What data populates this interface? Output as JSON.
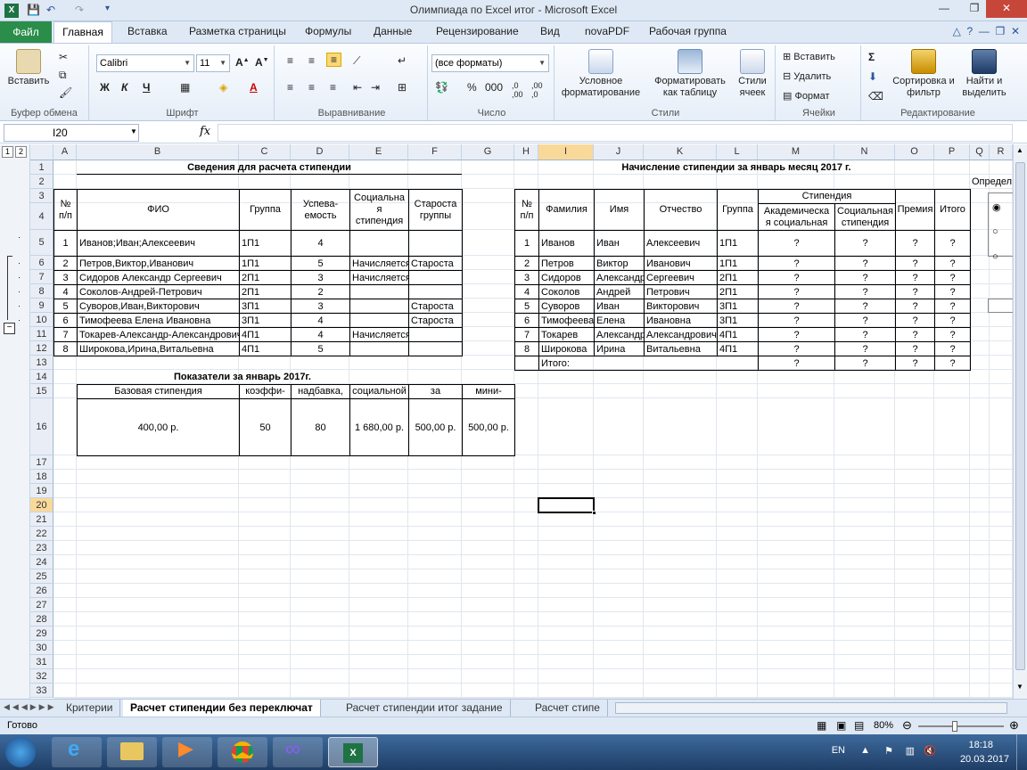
{
  "window": {
    "title": "Олимпиада по Excel итог  -  Microsoft Excel",
    "minimize": "—",
    "maximize": "❐",
    "close": "✕"
  },
  "ribbon_tabs": [
    "Главная",
    "Вставка",
    "Разметка страницы",
    "Формулы",
    "Данные",
    "Рецензирование",
    "Вид",
    "novaPDF",
    "Рабочая группа"
  ],
  "file_tab": "Файл",
  "ribbon": {
    "clipboard": {
      "label": "Буфер обмена",
      "paste": "Вставить"
    },
    "font": {
      "label": "Шрифт",
      "name": "Calibri",
      "size": "11",
      "bold": "Ж",
      "italic": "К",
      "underline": "Ч"
    },
    "alignment": {
      "label": "Выравнивание"
    },
    "number": {
      "label": "Число",
      "format": "(все форматы)",
      "percent": "%",
      "thousands": "000"
    },
    "styles": {
      "label": "Стили",
      "cond": "Условное форматирование",
      "table": "Форматировать как таблицу",
      "cellstyles": "Стили ячеек"
    },
    "cells": {
      "label": "Ячейки",
      "insert": "Вставить",
      "delete": "Удалить",
      "format": "Формат"
    },
    "editing": {
      "label": "Редактирование",
      "sum": "Σ",
      "sort": "Сортировка и фильтр",
      "find": "Найти и выделить"
    }
  },
  "formula_bar": {
    "name_box": "I20",
    "fx": "fx",
    "formula": ""
  },
  "columns": [
    "A",
    "B",
    "C",
    "D",
    "E",
    "F",
    "G",
    "H",
    "I",
    "J",
    "K",
    "L",
    "M",
    "N",
    "O",
    "P",
    "Q",
    "R"
  ],
  "rows": [
    "1",
    "2",
    "3",
    "4",
    "5",
    "6",
    "7",
    "8",
    "9",
    "10",
    "11",
    "12",
    "13",
    "14",
    "15",
    "16",
    "17",
    "18",
    "19",
    "20",
    "21",
    "22",
    "23",
    "24",
    "25",
    "26",
    "27",
    "28",
    "29",
    "30",
    "31",
    "32",
    "33"
  ],
  "outline": {
    "level1": "1",
    "level2": "2",
    "collapse": "−"
  },
  "left_table": {
    "title": "Сведения  для расчета стипендии",
    "headers": {
      "num": "№ п/п",
      "fio": "ФИО",
      "group": "Группа",
      "progress": "Успева-емость",
      "social": "Социальна я стипендия",
      "head": "Староста группы"
    },
    "rows": [
      {
        "n": "1",
        "fio": "Иванов;Иван;Алексеевич",
        "g": "1П1",
        "p": "4",
        "s": "",
        "h": ""
      },
      {
        "n": "2",
        "fio": "Петров,Виктор,Иванович",
        "g": "1П1",
        "p": "5",
        "s": "Начисляется",
        "h": "Староста"
      },
      {
        "n": "3",
        "fio": "Сидоров Александр Сергеевич",
        "g": "2П1",
        "p": "3",
        "s": "Начисляется",
        "h": ""
      },
      {
        "n": "4",
        "fio": "Соколов-Андрей-Петрович",
        "g": "2П1",
        "p": "2",
        "s": "",
        "h": ""
      },
      {
        "n": "5",
        "fio": "Суворов,Иван,Викторович",
        "g": "3П1",
        "p": "3",
        "s": "",
        "h": "Староста"
      },
      {
        "n": "6",
        "fio": "Тимофеева  Елена Ивановна",
        "g": "3П1",
        "p": "4",
        "s": "",
        "h": "Староста"
      },
      {
        "n": "7",
        "fio": "Токарев-Александр-Александрович",
        "g": "4П1",
        "p": "4",
        "s": "Начисляется",
        "h": ""
      },
      {
        "n": "8",
        "fio": "Широкова,Ирина,Витальевна",
        "g": "4П1",
        "p": "5",
        "s": "",
        "h": ""
      }
    ]
  },
  "indicators": {
    "title": "Показатели  за январь 2017г.",
    "headers": [
      "Базовая стипендия",
      "Районный коэффи-циент,%",
      "Северная надбавка, %",
      "Размер социальной стипендии",
      "Доплата за старосту",
      "Премия мини-мальная"
    ],
    "values": [
      "400,00 р.",
      "50",
      "80",
      "1 680,00 р.",
      "500,00 р.",
      "500,00 р."
    ]
  },
  "right_table": {
    "title": "Начисление стипендии за январь месяц 2017 г.",
    "headers": {
      "num": "№ п/п",
      "last": "Фамилия",
      "first": "Имя",
      "patr": "Отчество",
      "group": "Группа",
      "stip": "Стипендия",
      "acad": "Академическа я социальная",
      "social": "Социальная стипендия",
      "bonus": "Премия",
      "total": "Итого"
    },
    "rows": [
      {
        "n": "1",
        "l": "Иванов",
        "f": "Иван",
        "p": "Алексеевич",
        "g": "1П1"
      },
      {
        "n": "2",
        "l": "Петров",
        "f": "Виктор",
        "p": "Иванович",
        "g": "1П1"
      },
      {
        "n": "3",
        "l": "Сидоров",
        "f": "Александр",
        "p": "Сергеевич",
        "g": "2П1"
      },
      {
        "n": "4",
        "l": "Соколов",
        "f": "Андрей",
        "p": "Петрович",
        "g": "2П1"
      },
      {
        "n": "5",
        "l": "Суворов",
        "f": "Иван",
        "p": "Викторович",
        "g": "3П1"
      },
      {
        "n": "6",
        "l": "Тимофеева",
        "f": "Елена",
        "p": "Ивановна",
        "g": "3П1"
      },
      {
        "n": "7",
        "l": "Токарев",
        "f": "Александр",
        "p": "Александрович",
        "g": "4П1"
      },
      {
        "n": "8",
        "l": "Широкова",
        "f": "Ирина",
        "p": "Витальевна",
        "g": "4П1"
      }
    ],
    "placeholder": "?",
    "total_label": "Итого:",
    "side_label": "Определ"
  },
  "sheets": [
    "Критерии",
    "Расчет стипендии без переключат",
    "Расчет стипендии итог задание",
    "Расчет стипе"
  ],
  "active_sheet": 1,
  "status": {
    "ready": "Готово",
    "zoom": "80%"
  },
  "tray": {
    "lang": "EN",
    "time": "18:18",
    "date": "20.03.2017"
  }
}
